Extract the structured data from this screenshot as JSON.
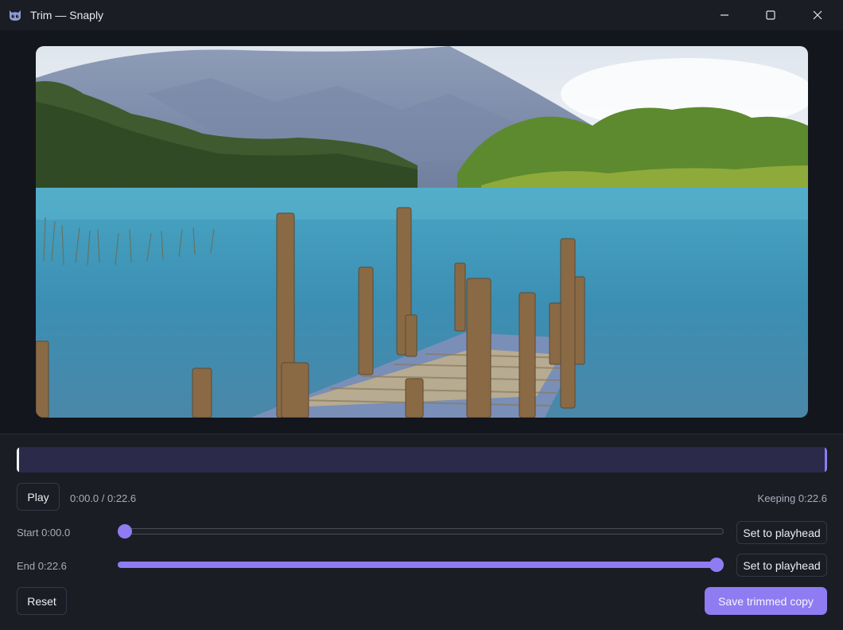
{
  "window": {
    "title": "Trim — Snaply",
    "app_icon": "cat-face-icon",
    "controls": [
      "minimize-icon",
      "maximize-icon",
      "close-icon"
    ]
  },
  "preview": {
    "scene": "lake-with-wooden-pier"
  },
  "timeline": {
    "selection_start": 0.0,
    "selection_end": 1.0
  },
  "playback": {
    "play_label": "Play",
    "time_display": "0:00.0 / 0:22.6",
    "keeping_display": "Keeping 0:22.6"
  },
  "trim": {
    "start_label": "Start 0:00.0",
    "start_fraction": 0.0,
    "end_label": "End 0:22.6",
    "end_fraction": 1.0,
    "set_to_playhead_label": "Set to playhead"
  },
  "actions": {
    "reset_label": "Reset",
    "save_label": "Save trimmed copy"
  },
  "colors": {
    "accent": "#8f7cf2",
    "background": "#14161d",
    "panel": "#1b1d25",
    "timeline": "#2c2a4a"
  }
}
